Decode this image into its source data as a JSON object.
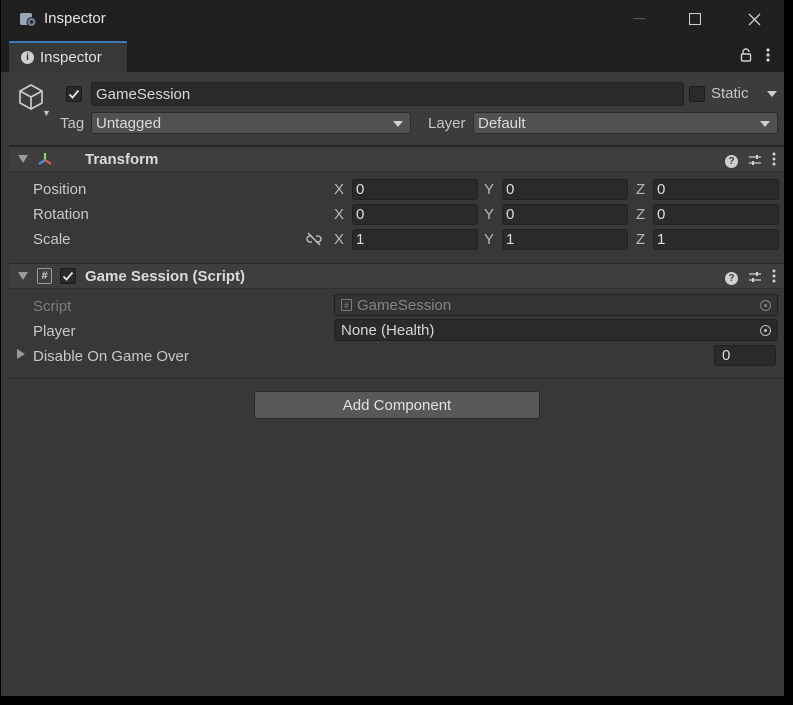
{
  "window": {
    "title": "Inspector"
  },
  "tab": {
    "label": "Inspector"
  },
  "gameobject": {
    "active": true,
    "name": "GameSession",
    "static_label": "Static",
    "static": false,
    "tag_label": "Tag",
    "tag_value": "Untagged",
    "layer_label": "Layer",
    "layer_value": "Default"
  },
  "transform": {
    "title": "Transform",
    "position": {
      "label": "Position",
      "x": "0",
      "y": "0",
      "z": "0"
    },
    "rotation": {
      "label": "Rotation",
      "x": "0",
      "y": "0",
      "z": "0"
    },
    "scale": {
      "label": "Scale",
      "x": "1",
      "y": "1",
      "z": "1"
    },
    "axis_x": "X",
    "axis_y": "Y",
    "axis_z": "Z"
  },
  "script_component": {
    "enabled": true,
    "title": "Game Session (Script)",
    "script_label": "Script",
    "script_value": "GameSession",
    "player_label": "Player",
    "player_value": "None (Health)",
    "disable_label": "Disable On Game Over",
    "disable_count": "0"
  },
  "add_component": {
    "label": "Add Component"
  },
  "colors": {
    "accent": "#3a79bb",
    "background": "#383838",
    "titlebar": "#202020"
  },
  "icons": [
    "unity-icon",
    "minimize-icon",
    "maximize-icon",
    "close-icon",
    "info-icon",
    "lock-icon",
    "kebab-menu-icon",
    "cube-icon",
    "transform-axes-icon",
    "help-icon",
    "presets-icon",
    "script-hash-icon",
    "unlinked-scale-icon",
    "object-picker-icon"
  ]
}
